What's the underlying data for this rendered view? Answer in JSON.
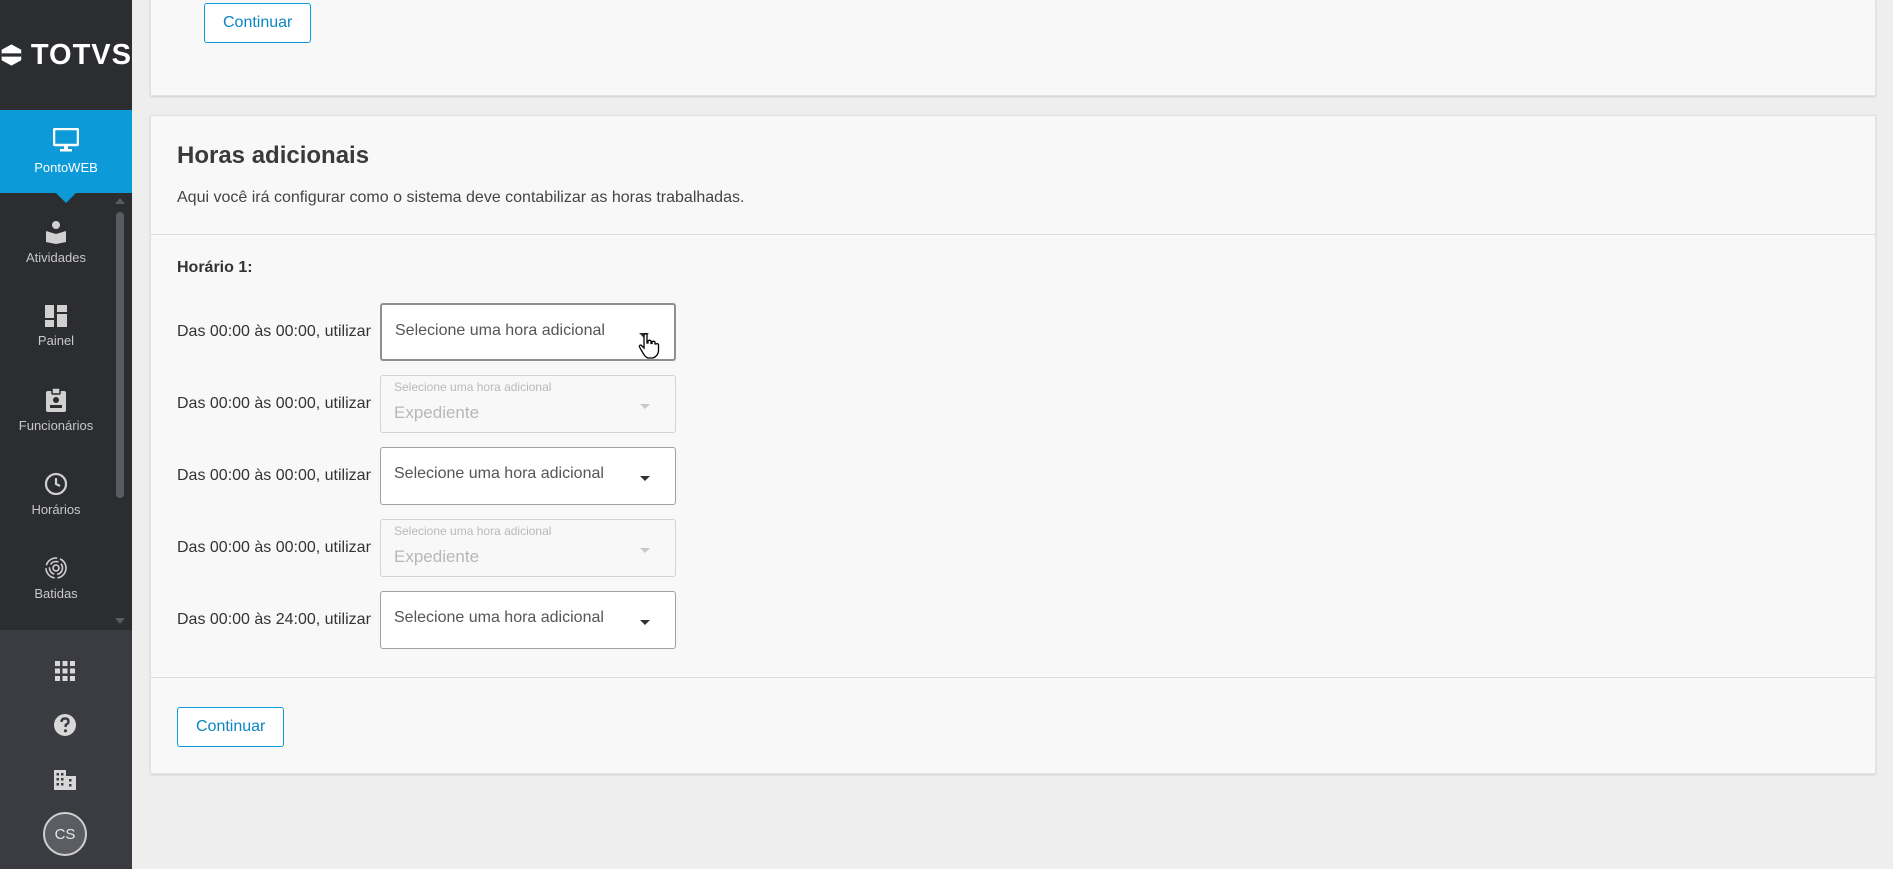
{
  "sidebar": {
    "logo": "TOTVS",
    "active": {
      "label": "PontoWEB",
      "icon": "monitor-icon"
    },
    "items": [
      {
        "label": "Atividades",
        "icon": "user-book-icon"
      },
      {
        "label": "Painel",
        "icon": "dashboard-icon"
      },
      {
        "label": "Funcionários",
        "icon": "badge-icon"
      },
      {
        "label": "Horários",
        "icon": "clock-icon"
      },
      {
        "label": "Batidas",
        "icon": "fingerprint-icon"
      }
    ],
    "bottom_icons": [
      "apps-grid-icon",
      "help-icon",
      "building-icon"
    ],
    "avatar": "CS"
  },
  "top_card": {
    "continue_label": "Continuar"
  },
  "main": {
    "title": "Horas adicionais",
    "description": "Aqui você irá configurar como o sistema deve contabilizar as horas trabalhadas.",
    "subtitle": "Horário 1:",
    "rows": [
      {
        "label": "Das 00:00 às 00:00, utilizar",
        "placeholder": "Selecione uma hora adicional",
        "value": ""
      },
      {
        "label": "Das 00:00 às 00:00, utilizar",
        "placeholder": "Selecione uma hora adicional",
        "value": "Expediente"
      },
      {
        "label": "Das 00:00 às 00:00, utilizar",
        "placeholder": "Selecione uma hora adicional",
        "value": ""
      },
      {
        "label": "Das 00:00 às 00:00, utilizar",
        "placeholder": "Selecione uma hora adicional",
        "value": "Expediente"
      },
      {
        "label": "Das 00:00 às 24:00, utilizar",
        "placeholder": "Selecione uma hora adicional",
        "value": ""
      }
    ],
    "continue_label": "Continuar"
  },
  "colors": {
    "accent": "#0c9ad9",
    "sidebar_bg": "#2b2d31",
    "page_bg": "#eeeeef"
  }
}
